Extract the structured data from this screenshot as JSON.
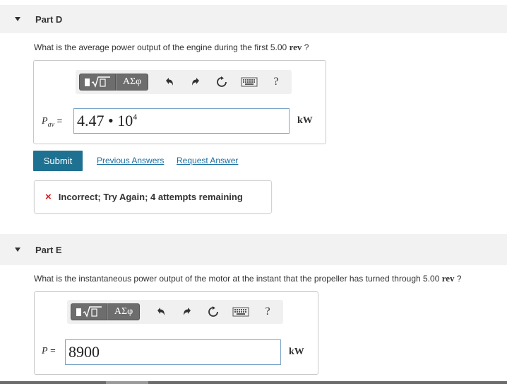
{
  "partD": {
    "title": "Part D",
    "question_prefix": "What is the average power output of the engine during the first 5.00 ",
    "question_unit": "rev",
    "question_suffix": " ?",
    "toolbar": {
      "template_label": "▯√▯",
      "greek_label": "ΑΣφ",
      "undo_icon": "undo-icon",
      "redo_icon": "redo-icon",
      "reset_icon": "reset-icon",
      "keyboard_icon": "keyboard-icon",
      "help_label": "?"
    },
    "variable": "P",
    "variable_sub": "av",
    "equals": " =",
    "answer_main": "4.47 • 10",
    "answer_exp": "4",
    "unit": "kW",
    "submit_label": "Submit",
    "previous_answers_label": "Previous Answers",
    "request_answer_label": "Request Answer",
    "feedback_icon": "×",
    "feedback_text": "Incorrect; Try Again; 4 attempts remaining"
  },
  "partE": {
    "title": "Part E",
    "question_prefix": "What is the instantaneous power output of the motor at the instant that the propeller has turned through 5.00 ",
    "question_unit": "rev",
    "question_suffix": " ?",
    "toolbar": {
      "template_label": "▯√▯",
      "greek_label": "ΑΣφ",
      "help_label": "?"
    },
    "variable": "P",
    "equals": " =",
    "answer_value": "8900",
    "unit": "kW"
  },
  "colors": {
    "submit": "#1f7191",
    "link": "#1a6fa3",
    "error": "#d21f1f",
    "input_border": "#7aa6c8"
  }
}
